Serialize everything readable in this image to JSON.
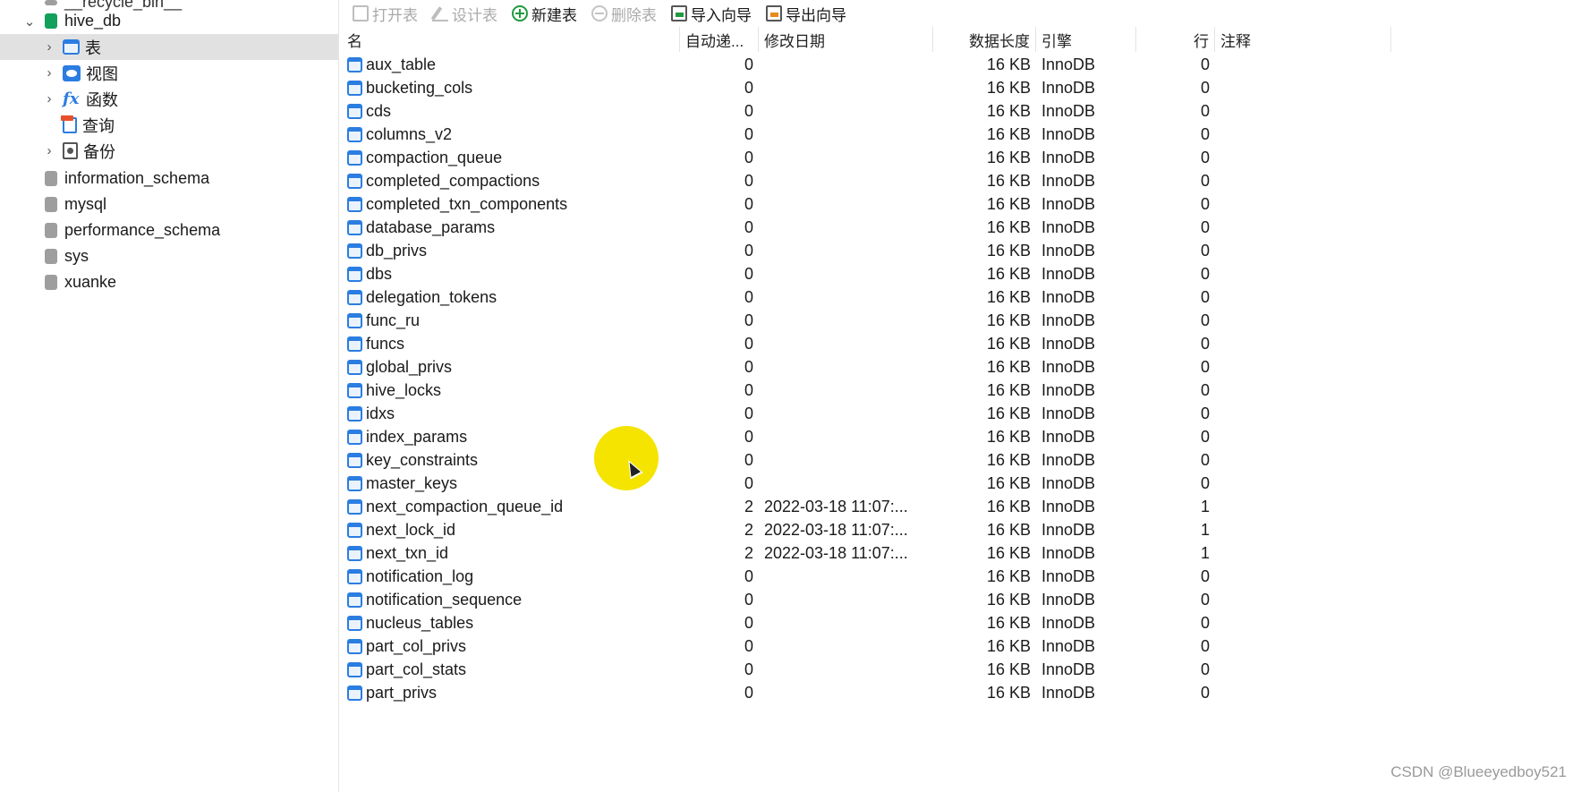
{
  "sidebar": {
    "items": [
      {
        "label": "__recycle_bin__",
        "type": "database-recycle",
        "indent": 0
      },
      {
        "label": "hive_db",
        "type": "database-open",
        "indent": 0
      },
      {
        "label": "表",
        "type": "tables",
        "selected": true
      },
      {
        "label": "视图",
        "type": "views"
      },
      {
        "label": "函数",
        "type": "functions"
      },
      {
        "label": "查询",
        "type": "queries"
      },
      {
        "label": "备份",
        "type": "backups"
      },
      {
        "label": "information_schema",
        "type": "database"
      },
      {
        "label": "mysql",
        "type": "database"
      },
      {
        "label": "performance_schema",
        "type": "database"
      },
      {
        "label": "sys",
        "type": "database"
      },
      {
        "label": "xuanke",
        "type": "database"
      }
    ]
  },
  "toolbar": {
    "open_table": "打开表",
    "design_table": "设计表",
    "new_table": "新建表",
    "delete_table": "删除表",
    "import_wizard": "导入向导",
    "export_wizard": "导出向导"
  },
  "table": {
    "columns": [
      "名",
      "自动递...",
      "修改日期",
      "数据长度",
      "引擎",
      "行",
      "注释"
    ],
    "rows": [
      {
        "name": "aux_table",
        "auto": "0",
        "date": "",
        "length": "16 KB",
        "engine": "InnoDB",
        "rows": "0"
      },
      {
        "name": "bucketing_cols",
        "auto": "0",
        "date": "",
        "length": "16 KB",
        "engine": "InnoDB",
        "rows": "0"
      },
      {
        "name": "cds",
        "auto": "0",
        "date": "",
        "length": "16 KB",
        "engine": "InnoDB",
        "rows": "0"
      },
      {
        "name": "columns_v2",
        "auto": "0",
        "date": "",
        "length": "16 KB",
        "engine": "InnoDB",
        "rows": "0"
      },
      {
        "name": "compaction_queue",
        "auto": "0",
        "date": "",
        "length": "16 KB",
        "engine": "InnoDB",
        "rows": "0"
      },
      {
        "name": "completed_compactions",
        "auto": "0",
        "date": "",
        "length": "16 KB",
        "engine": "InnoDB",
        "rows": "0"
      },
      {
        "name": "completed_txn_components",
        "auto": "0",
        "date": "",
        "length": "16 KB",
        "engine": "InnoDB",
        "rows": "0"
      },
      {
        "name": "database_params",
        "auto": "0",
        "date": "",
        "length": "16 KB",
        "engine": "InnoDB",
        "rows": "0"
      },
      {
        "name": "db_privs",
        "auto": "0",
        "date": "",
        "length": "16 KB",
        "engine": "InnoDB",
        "rows": "0"
      },
      {
        "name": "dbs",
        "auto": "0",
        "date": "",
        "length": "16 KB",
        "engine": "InnoDB",
        "rows": "0"
      },
      {
        "name": "delegation_tokens",
        "auto": "0",
        "date": "",
        "length": "16 KB",
        "engine": "InnoDB",
        "rows": "0"
      },
      {
        "name": "func_ru",
        "auto": "0",
        "date": "",
        "length": "16 KB",
        "engine": "InnoDB",
        "rows": "0"
      },
      {
        "name": "funcs",
        "auto": "0",
        "date": "",
        "length": "16 KB",
        "engine": "InnoDB",
        "rows": "0"
      },
      {
        "name": "global_privs",
        "auto": "0",
        "date": "",
        "length": "16 KB",
        "engine": "InnoDB",
        "rows": "0"
      },
      {
        "name": "hive_locks",
        "auto": "0",
        "date": "",
        "length": "16 KB",
        "engine": "InnoDB",
        "rows": "0"
      },
      {
        "name": "idxs",
        "auto": "0",
        "date": "",
        "length": "16 KB",
        "engine": "InnoDB",
        "rows": "0"
      },
      {
        "name": "index_params",
        "auto": "0",
        "date": "",
        "length": "16 KB",
        "engine": "InnoDB",
        "rows": "0"
      },
      {
        "name": "key_constraints",
        "auto": "0",
        "date": "",
        "length": "16 KB",
        "engine": "InnoDB",
        "rows": "0"
      },
      {
        "name": "master_keys",
        "auto": "0",
        "date": "",
        "length": "16 KB",
        "engine": "InnoDB",
        "rows": "0"
      },
      {
        "name": "next_compaction_queue_id",
        "auto": "2",
        "date": "2022-03-18 11:07:...",
        "length": "16 KB",
        "engine": "InnoDB",
        "rows": "1"
      },
      {
        "name": "next_lock_id",
        "auto": "2",
        "date": "2022-03-18 11:07:...",
        "length": "16 KB",
        "engine": "InnoDB",
        "rows": "1"
      },
      {
        "name": "next_txn_id",
        "auto": "2",
        "date": "2022-03-18 11:07:...",
        "length": "16 KB",
        "engine": "InnoDB",
        "rows": "1"
      },
      {
        "name": "notification_log",
        "auto": "0",
        "date": "",
        "length": "16 KB",
        "engine": "InnoDB",
        "rows": "0"
      },
      {
        "name": "notification_sequence",
        "auto": "0",
        "date": "",
        "length": "16 KB",
        "engine": "InnoDB",
        "rows": "0"
      },
      {
        "name": "nucleus_tables",
        "auto": "0",
        "date": "",
        "length": "16 KB",
        "engine": "InnoDB",
        "rows": "0"
      },
      {
        "name": "part_col_privs",
        "auto": "0",
        "date": "",
        "length": "16 KB",
        "engine": "InnoDB",
        "rows": "0"
      },
      {
        "name": "part_col_stats",
        "auto": "0",
        "date": "",
        "length": "16 KB",
        "engine": "InnoDB",
        "rows": "0"
      },
      {
        "name": "part_privs",
        "auto": "0",
        "date": "",
        "length": "16 KB",
        "engine": "InnoDB",
        "rows": "0"
      }
    ]
  },
  "watermark": "CSDN @Blueeyedboy521",
  "colors": {
    "selected_bg": "#e1e1e1",
    "table_icon": "#2b7de1",
    "db_open": "#13a05a",
    "db_closed": "#9e9e9e",
    "cursor_halo": "#f4e400"
  }
}
